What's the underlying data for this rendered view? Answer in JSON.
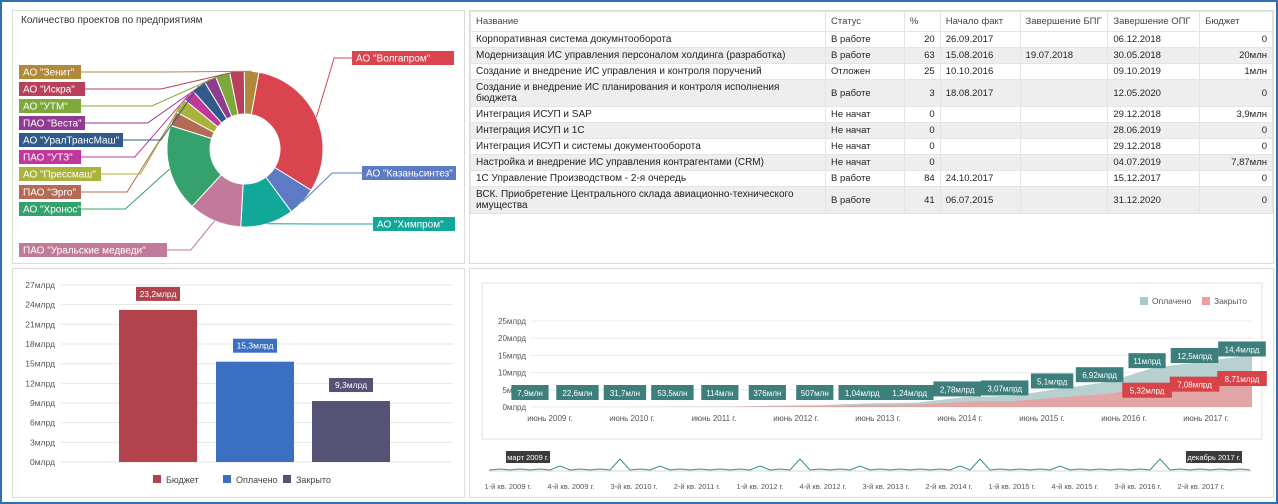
{
  "pie": {
    "title": "Количество проектов по предприятиям",
    "slices": [
      {
        "label": "АО \"Волгапром\"",
        "value": 31,
        "color": "#d9444e"
      },
      {
        "label": "АО \"Казаньсинтез\"",
        "value": 6,
        "color": "#5d7ac4"
      },
      {
        "label": "АО \"Химпром\"",
        "value": 11,
        "color": "#11a89a"
      },
      {
        "label": "ПАО \"Уральские медведи\"",
        "value": 11,
        "color": "#c17a9a"
      },
      {
        "label": "АО \"Хронос\"",
        "value": 18,
        "color": "#35a16d"
      },
      {
        "label": "ПАО \"Эрго\"",
        "value": 3,
        "color": "#b36b56"
      },
      {
        "label": "АО \"Прессмаш\"",
        "value": 3,
        "color": "#a9b23a"
      },
      {
        "label": "ПАО \"УТЗ\"",
        "value": 2.5,
        "color": "#c0399a"
      },
      {
        "label": "АО \"УралТрансМаш\"",
        "value": 3,
        "color": "#2f5a8a"
      },
      {
        "label": "ПАО \"Веста\"",
        "value": 2.5,
        "color": "#8f3b8f"
      },
      {
        "label": "АО \"УТМ\"",
        "value": 3,
        "color": "#7fa83a"
      },
      {
        "label": "АО \"Искра\"",
        "value": 3,
        "color": "#b8405a"
      },
      {
        "label": "АО \"Зенит\"",
        "value": 3,
        "color": "#b08a3a"
      }
    ]
  },
  "table": {
    "headers": [
      "Название",
      "Статус",
      "%",
      "Начало факт",
      "Завершение БПГ",
      "Завершение ОПГ",
      "Бюджет"
    ],
    "rows": [
      [
        "Корпоративная система докумнтооборота",
        "В работе",
        "20",
        "26.09.2017",
        "",
        "06.12.2018",
        "0"
      ],
      [
        "Модернизация ИС управления персоналом холдинга (разработка)",
        "В работе",
        "63",
        "15.08.2016",
        "19.07.2018",
        "30.05.2018",
        "20млн"
      ],
      [
        "Создание и внедрение ИС управления и контроля поручений",
        "Отложен",
        "25",
        "10.10.2016",
        "",
        "09.10.2019",
        "1млн"
      ],
      [
        "Создание и внедрение ИС планирования и контроля исполнения бюджета",
        "В работе",
        "3",
        "18.08.2017",
        "",
        "12.05.2020",
        "0"
      ],
      [
        "Интеграция ИСУП и SAP",
        "Не начат",
        "0",
        "",
        "",
        "29.12.2018",
        "3,9млн"
      ],
      [
        "Интеграция ИСУП и 1С",
        "Не начат",
        "0",
        "",
        "",
        "28.06.2019",
        "0"
      ],
      [
        "Интеграция ИСУП и системы документооборота",
        "Не начат",
        "0",
        "",
        "",
        "29.12.2018",
        "0"
      ],
      [
        "Настройка и внедрение ИС управления контрагентами (CRM)",
        "Не начат",
        "0",
        "",
        "",
        "04.07.2019",
        "7,87млн"
      ],
      [
        "1С Управление Производством - 2-я очередь",
        "В работе",
        "84",
        "24.10.2017",
        "",
        "15.12.2017",
        "0"
      ],
      [
        "ВСК. Приобретение Центрального склада авиационно-технического имущества",
        "В работе",
        "41",
        "06.07.2015",
        "",
        "31.12.2020",
        "0"
      ]
    ]
  },
  "chart_data": [
    {
      "type": "bar",
      "categories": [
        "Бюджет",
        "Оплачено",
        "Закрыто"
      ],
      "values": [
        23.2,
        15.3,
        9.3
      ],
      "value_labels": [
        "23,2млрд",
        "15,3млрд",
        "9,3млрд"
      ],
      "colors": [
        "#b2424b",
        "#3a6fc1",
        "#545275"
      ],
      "yticks": [
        "0млрд",
        "3млрд",
        "6млрд",
        "9млрд",
        "12млрд",
        "15млрд",
        "18млрд",
        "21млрд",
        "24млрд",
        "27млрд"
      ],
      "ylim": [
        0,
        27
      ]
    },
    {
      "type": "area",
      "legend": [
        {
          "name": "Оплачено",
          "color": "#a9c9c8"
        },
        {
          "name": "Закрыто",
          "color": "#e8a0a0"
        }
      ],
      "yticks": [
        "0млрд",
        "5млрд",
        "10млрд",
        "15млрд",
        "20млрд",
        "25млрд"
      ],
      "ylim": [
        0,
        25
      ],
      "xticks": [
        "июнь 2009 г.",
        "июнь 2010 г.",
        "июнь 2011 г.",
        "июнь 2012 г.",
        "июнь 2013 г.",
        "июнь 2014 г.",
        "июнь 2015 г.",
        "июнь 2016 г.",
        "июнь 2017 г."
      ],
      "paid_labels": [
        "7,9млн",
        "22,6млн",
        "31,7млн",
        "53,5млн",
        "114млн",
        "376млн",
        "507млн",
        "1,04млрд",
        "1,24млрд",
        "2,78млрд",
        "3,07млрд",
        "5,1млрд",
        "6,92млрд",
        "11млрд",
        "12,5млрд",
        "14,4млрд"
      ],
      "paid_values": [
        0.008,
        0.023,
        0.032,
        0.054,
        0.114,
        0.376,
        0.507,
        1.04,
        1.24,
        2.78,
        3.07,
        5.1,
        6.92,
        11,
        12.5,
        14.4
      ],
      "closed_labels": [
        "5,32млрд",
        "7,08млрд",
        "8,71млрд"
      ],
      "closed_values": [
        5.32,
        7.08,
        8.71
      ]
    }
  ],
  "navigator": {
    "start_label": "март 2009 г.",
    "end_label": "декабрь 2017 г.",
    "ticks": [
      "1-й кв. 2009 г.",
      "4-й кв. 2009 г.",
      "3-й кв. 2010 г.",
      "2-й кв. 2011 г.",
      "1-й кв. 2012 г.",
      "4-й кв. 2012 г.",
      "3-й кв. 2013 г.",
      "2-й кв. 2014 г.",
      "1-й кв. 2015 г.",
      "4-й кв. 2015 г.",
      "3-й кв. 2016 г.",
      "2-й кв. 2017 г."
    ]
  }
}
